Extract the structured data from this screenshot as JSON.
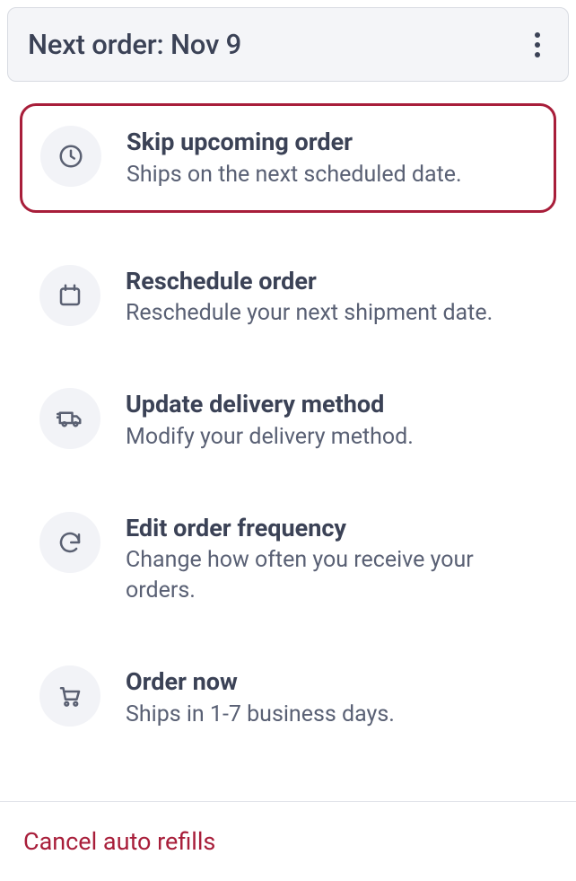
{
  "header": {
    "title": "Next order: Nov 9"
  },
  "options": [
    {
      "icon": "clock",
      "title": "Skip upcoming order",
      "desc": "Ships on the next scheduled date.",
      "highlight": true
    },
    {
      "icon": "calendar",
      "title": "Reschedule order",
      "desc": "Reschedule your next shipment date."
    },
    {
      "icon": "truck",
      "title": "Update delivery method",
      "desc": "Modify your delivery method."
    },
    {
      "icon": "refresh",
      "title": "Edit order frequency",
      "desc": "Change how often you receive your orders."
    },
    {
      "icon": "cart",
      "title": "Order now",
      "desc": "Ships in 1-7 business days."
    }
  ],
  "cancel_label": "Cancel auto refills"
}
